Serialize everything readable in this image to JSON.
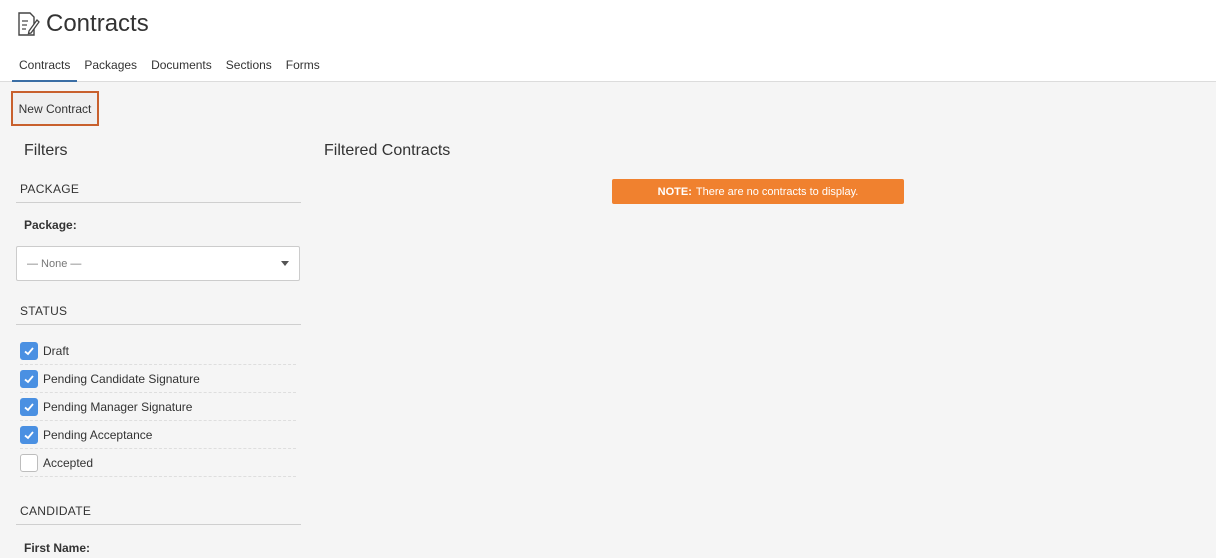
{
  "header": {
    "title": "Contracts",
    "icon": "contract-edit-icon",
    "tabs": [
      {
        "label": "Contracts",
        "active": true
      },
      {
        "label": "Packages",
        "active": false
      },
      {
        "label": "Documents",
        "active": false
      },
      {
        "label": "Sections",
        "active": false
      },
      {
        "label": "Forms",
        "active": false
      }
    ]
  },
  "toolbar": {
    "new_contract_label": "New Contract"
  },
  "filters": {
    "title": "Filters",
    "package": {
      "section_label": "PACKAGE",
      "field_label": "Package:",
      "selected": "— None —"
    },
    "status": {
      "section_label": "STATUS",
      "items": [
        {
          "label": "Draft",
          "checked": true
        },
        {
          "label": "Pending Candidate Signature",
          "checked": true
        },
        {
          "label": "Pending Manager Signature",
          "checked": true
        },
        {
          "label": "Pending Acceptance",
          "checked": true
        },
        {
          "label": "Accepted",
          "checked": false
        }
      ]
    },
    "candidate": {
      "section_label": "CANDIDATE",
      "first_name_label": "First Name:"
    }
  },
  "results": {
    "title": "Filtered Contracts",
    "note_prefix": "NOTE:",
    "note_text": "There are no contracts to display."
  },
  "colors": {
    "accent_blue": "#4a90e2",
    "note_orange": "#f0812f",
    "highlight_border": "#c8602d",
    "active_tab": "#3a6ea5"
  }
}
